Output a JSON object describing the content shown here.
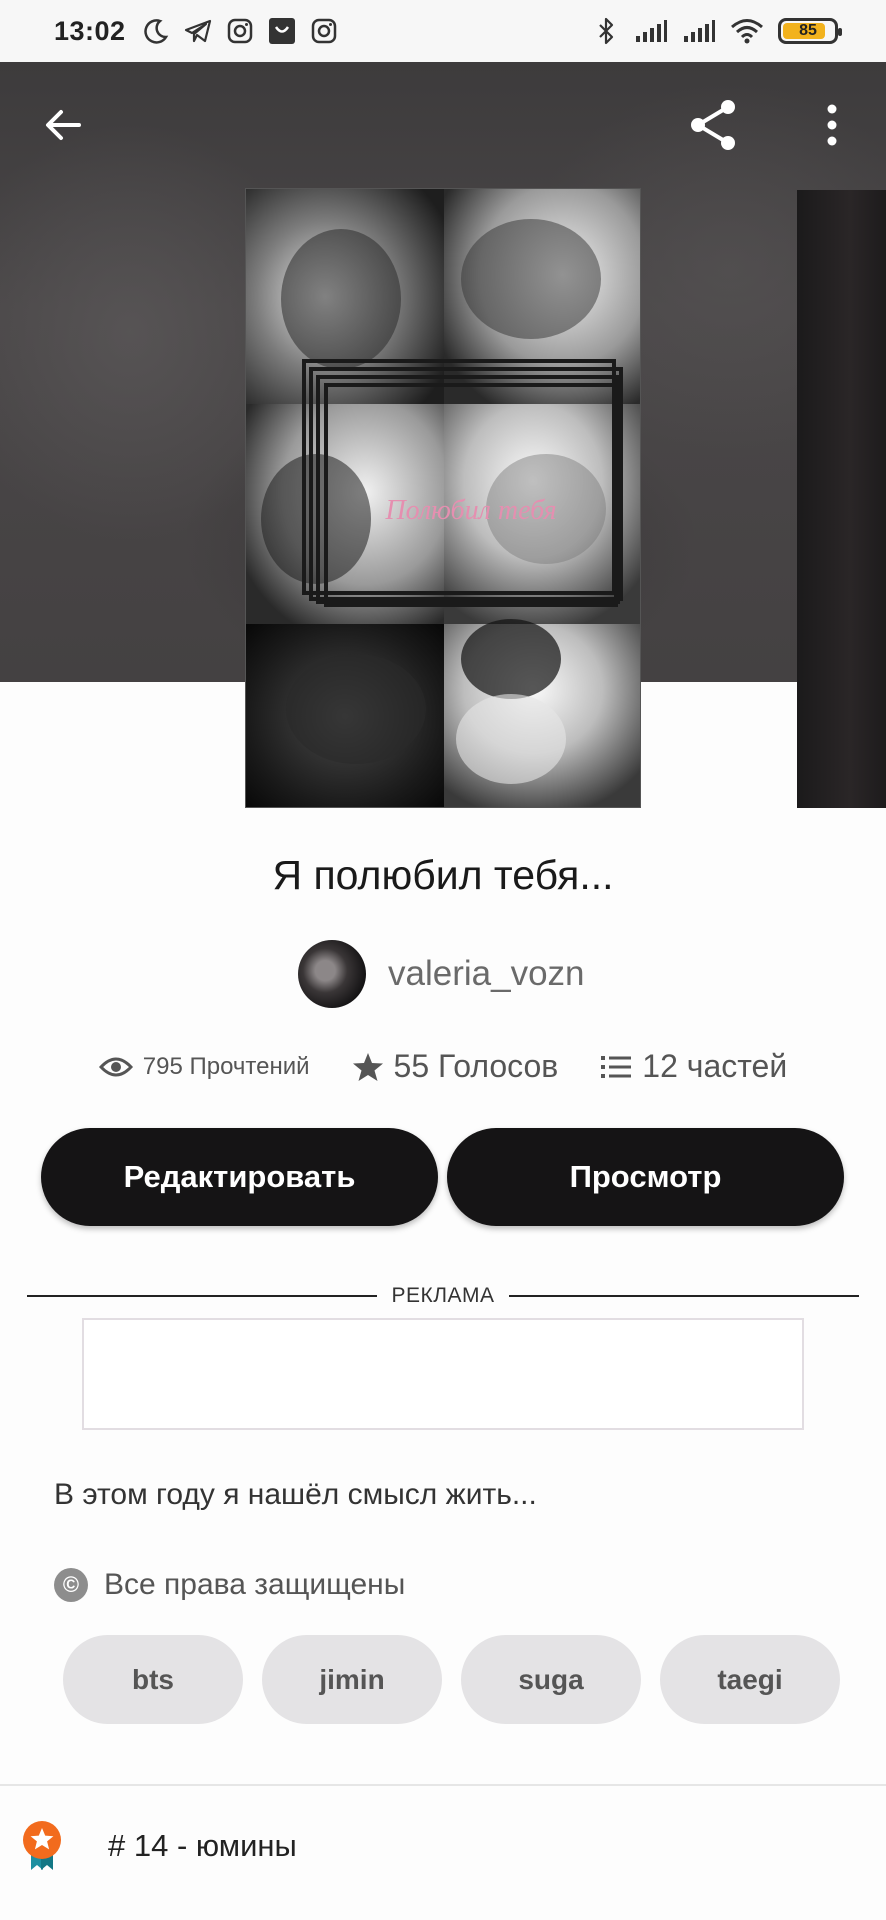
{
  "status_bar": {
    "time": "13:02",
    "battery": "85",
    "battery_level": 0.85,
    "icons_left": [
      "moon-icon",
      "telegram-icon",
      "instagram-icon",
      "shop-icon",
      "instagram-icon"
    ],
    "icons_right": [
      "bluetooth-icon",
      "signal-icon",
      "signal-icon",
      "wifi-icon"
    ]
  },
  "app_bar": {
    "icons": [
      "back-arrow-icon",
      "share-icon",
      "more-vert-icon"
    ]
  },
  "cover": {
    "title_text": "Полюбил тебя"
  },
  "story": {
    "title": "Я полюбил тебя...",
    "author": "valeria_vozn",
    "reads": "795 Прочтений",
    "votes": "55 Голосов",
    "parts": "12 частей",
    "description": "В этом году я нашёл смысл жить...",
    "copyright": "Все права защищены"
  },
  "actions": {
    "edit_label": "Редактировать",
    "preview_label": "Просмотр"
  },
  "ad": {
    "label": "РЕКЛАМА"
  },
  "tags": [
    "bts",
    "jimin",
    "suga",
    "taegi"
  ],
  "ranking": {
    "text": "# 14 - юмины"
  },
  "colors": {
    "button_bg": "#151415",
    "tag_bg": "#e4e3e5",
    "ranking_badge": "#f26b1d",
    "ribbon": "#1c8fa0",
    "battery_fill": "#f2b21d"
  }
}
